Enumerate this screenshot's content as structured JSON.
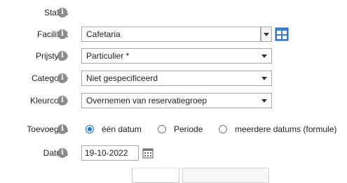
{
  "form": {
    "status": {
      "label": "Status"
    },
    "faciliteit": {
      "label": "Faciliteit",
      "value": "Cafetaria"
    },
    "prijstype": {
      "label": "Prijstype",
      "value": "Particulier *"
    },
    "categorie": {
      "label": "Categorie",
      "value": "Niet gespecificeerd"
    },
    "kleurcode": {
      "label": "Kleurcode",
      "value": "Overnemen van reservatiegroep"
    },
    "toevoegen": {
      "label": "Toevoegen",
      "options": [
        "één datum",
        "Periode",
        "meerdere datums (formule)"
      ],
      "selected": "één datum"
    },
    "datum": {
      "label": "Datum",
      "value": "19-10-2022"
    }
  },
  "icons": {
    "info": "info-icon",
    "calendar": "calendar-icon",
    "window": "window-grid-icon"
  },
  "colors": {
    "accent": "#1a73e8",
    "info_badge": "#8c8c8c",
    "border": "#a9a9a9"
  }
}
